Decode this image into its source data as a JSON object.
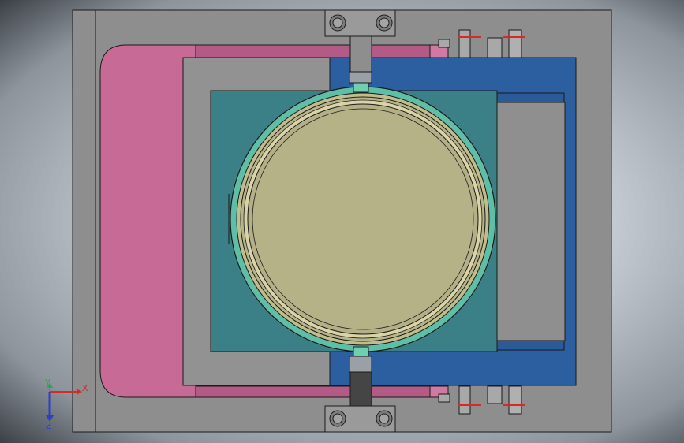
{
  "viewport": {
    "background": "#c3c9d1",
    "colors": {
      "base_plate": "#8e8e8e",
      "pink_part": "#c76b96",
      "pink_dark": "#a9517c",
      "gray_block": "#909090",
      "blue_frame": "#2c5fa0",
      "teal_block": "#3b8087",
      "ring": "#5fbfa6",
      "disc": "#b3b087",
      "outline": "#1a1a1a"
    }
  },
  "triad": {
    "x_label": "X",
    "y_label": "Y",
    "z_label": "Z",
    "x_color": "#d62a2a",
    "y_color": "#2ba84a",
    "z_color": "#2b3fc8"
  }
}
